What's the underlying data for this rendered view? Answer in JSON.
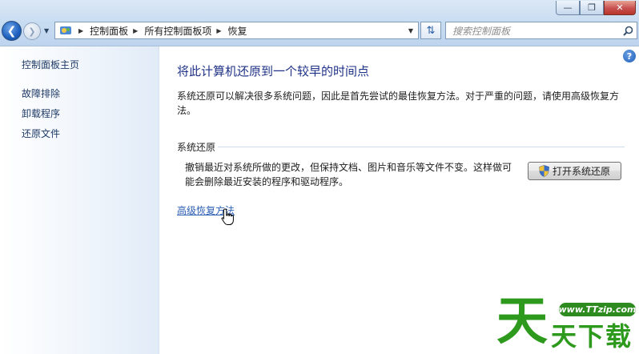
{
  "window": {
    "minimize_icon": "minimize-icon",
    "maximize_icon": "maximize-icon",
    "close_icon": "close-icon"
  },
  "address_bar": {
    "crumbs": [
      "控制面板",
      "所有控制面板项",
      "恢复"
    ],
    "search_placeholder": "搜索控制面板"
  },
  "sidebar": {
    "home": "控制面板主页",
    "items": [
      "故障排除",
      "卸载程序",
      "还原文件"
    ]
  },
  "main": {
    "title": "将此计算机还原到一个较早的时间点",
    "description": "系统还原可以解决很多系统问题，因此是首先尝试的最佳恢复方法。对于严重的问题，请使用高级恢复方法。",
    "section_label": "系统还原",
    "section_text": "撤销最近对系统所做的更改，但保持文档、图片和音乐等文件不变。这样做可能会删除最近安装的程序和驱动程序。",
    "open_button": "打开系统还原",
    "advanced_link": "高级恢复方法"
  },
  "watermark": {
    "url": "www.TTzip.com",
    "big": "天",
    "small": "天下载"
  },
  "colors": {
    "title": "#1e3287",
    "link": "#2c5fb3",
    "watermark": "#2e9a1d"
  }
}
